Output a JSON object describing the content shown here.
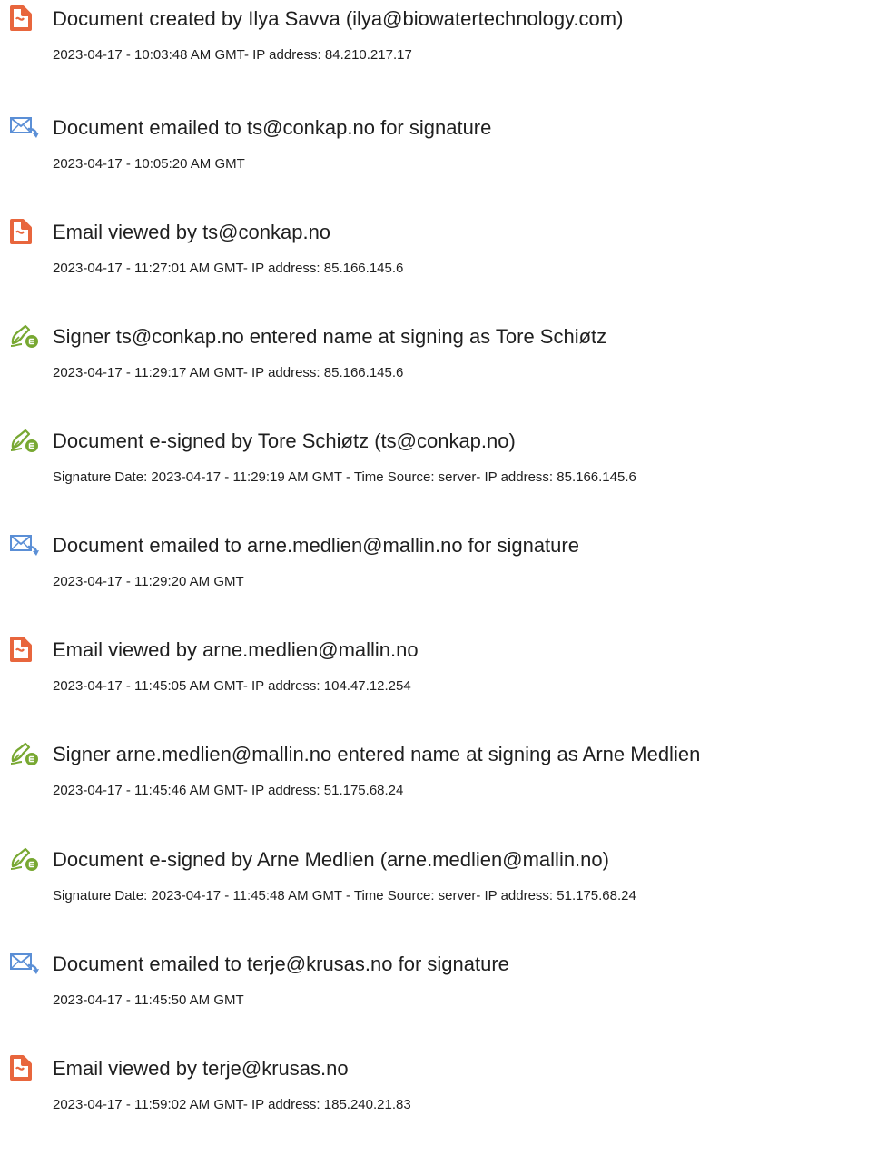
{
  "events": [
    {
      "icon": "document-created-icon",
      "title": "Document created by Ilya Savva (ilya@biowatertechnology.com)",
      "detail": "2023-04-17 - 10:03:48 AM GMT- IP address: 84.210.217.17"
    },
    {
      "icon": "email-sent-icon",
      "title": "Document emailed to ts@conkap.no for signature",
      "detail": "2023-04-17 - 10:05:20 AM GMT"
    },
    {
      "icon": "document-viewed-icon",
      "title": "Email viewed by ts@conkap.no",
      "detail": "2023-04-17 - 11:27:01 AM GMT- IP address: 85.166.145.6"
    },
    {
      "icon": "esign-pen-icon",
      "title": "Signer ts@conkap.no entered name at signing as Tore Schiøtz",
      "detail": "2023-04-17 - 11:29:17 AM GMT- IP address: 85.166.145.6"
    },
    {
      "icon": "esign-pen-icon",
      "title": "Document e-signed by Tore Schiøtz (ts@conkap.no)",
      "detail": "Signature Date: 2023-04-17 - 11:29:19 AM GMT - Time Source: server- IP address: 85.166.145.6"
    },
    {
      "icon": "email-sent-icon",
      "title": "Document emailed to arne.medlien@mallin.no for signature",
      "detail": "2023-04-17 - 11:29:20 AM GMT"
    },
    {
      "icon": "document-viewed-icon",
      "title": "Email viewed by arne.medlien@mallin.no",
      "detail": "2023-04-17 - 11:45:05 AM GMT- IP address: 104.47.12.254"
    },
    {
      "icon": "esign-pen-icon",
      "title": "Signer arne.medlien@mallin.no entered name at signing as Arne Medlien",
      "detail": "2023-04-17 - 11:45:46 AM GMT- IP address: 51.175.68.24"
    },
    {
      "icon": "esign-pen-icon",
      "title": "Document e-signed by Arne Medlien (arne.medlien@mallin.no)",
      "detail": "Signature Date: 2023-04-17 - 11:45:48 AM GMT - Time Source: server- IP address: 51.175.68.24"
    },
    {
      "icon": "email-sent-icon",
      "title": "Document emailed to terje@krusas.no for signature",
      "detail": "2023-04-17 - 11:45:50 AM GMT"
    },
    {
      "icon": "document-viewed-icon",
      "title": "Email viewed by terje@krusas.no",
      "detail": "2023-04-17 - 11:59:02 AM GMT- IP address: 185.240.21.83"
    }
  ],
  "colors": {
    "document_icon": "#e8663d",
    "email_icon": "#5b8fd6",
    "pen_icon": "#78a832",
    "text": "#1f1f1f"
  }
}
